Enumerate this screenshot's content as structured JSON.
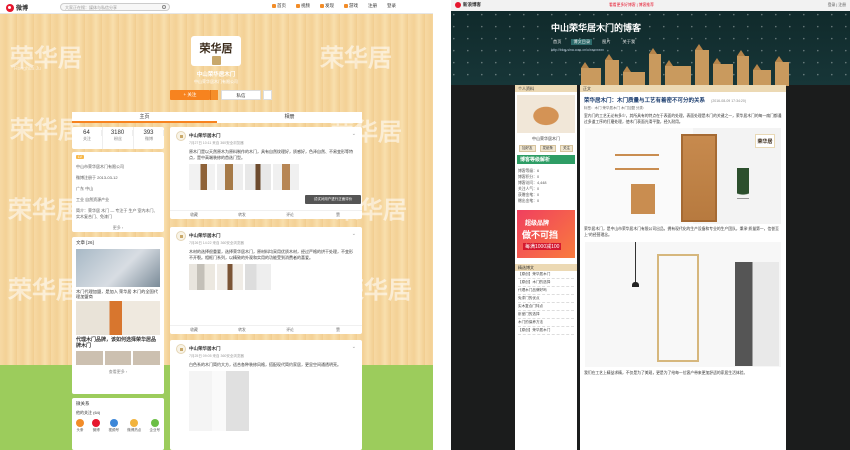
{
  "weibo": {
    "logo_text": "微博",
    "search_placeholder": "大家正在搜：媒体与私信分享",
    "nav": [
      "首页",
      "视频",
      "发现",
      "游戏",
      "注册",
      "登录"
    ],
    "watermark": [
      "荣华居",
      "荣华居",
      "荣华居",
      "荣华居",
      "荣华居",
      "荣华居",
      "荣华居",
      "荣华居"
    ],
    "watermark_sub": "Ronghua Ju",
    "brand_logo": "荣华居",
    "profile_name": "中山荣华居木门",
    "profile_sub": "中山荣华居木门有限公司",
    "follow_label": "+ 关注",
    "message_label": "私信",
    "tabs": [
      "主页",
      "相册"
    ],
    "stats": [
      {
        "n": "64",
        "l": "关注"
      },
      {
        "n": "3180",
        "l": "粉丝"
      },
      {
        "n": "393",
        "l": "微博"
      }
    ],
    "info": {
      "level": "LV",
      "company": "中山市荣华居木门有限公司",
      "registered": "微博注册于 2013-03-12",
      "location": "广东 中山",
      "industry": "工业 自然资源产业",
      "desc": "简介：荣华居 木门 — 专注于 生产 室内木门、实木复合门、免漆门",
      "more": "更多 ›"
    },
    "album": {
      "title": "文章 [26]",
      "caption1": "木门代理加盟，是加入 荣华居 木门的全国代理加盟商",
      "caption2": "代理木门品牌，该如何选择荣华居品牌木门",
      "more": "查看更多 ›"
    },
    "apps": {
      "title": "微关系",
      "sub": "他的关注 (64)",
      "items": [
        "头条",
        "微博",
        "视频号",
        "微博热点",
        "企业号"
      ]
    },
    "posts": [
      {
        "name": "中山荣华居木门",
        "time": "7月27日 10:11 来自 360安全浏览器",
        "text": "原木门是以天然原木为原料制作的木门，具有自然纹理好，质感好，色泽自然、不易变形等特点，是中高端装修的首选门型。",
        "actions": [
          "收藏",
          "转发",
          "评论",
          "赞"
        ]
      },
      {
        "name": "中山荣华居木门",
        "time": "7月26日 14:22 来自 360安全浏览器",
        "text": "木材的选择很重要，选择荣华居木门，原材料均采用优质木材，经过严格的烘干处理，不变形不开裂。相框门系列，以精致的外观和实用的功能受到消费者的喜爱。",
        "actions": [
          "收藏",
          "转发",
          "评论",
          "赞"
        ]
      },
      {
        "name": "中山荣华居木门",
        "time": "7月25日 09:05 来自 360安全浏览器",
        "text": "白色系的木门简约大方，适合各种装修风格，搭配现代简约家居，更显空间通透明亮。",
        "actions": [
          "收藏",
          "转发",
          "评论",
          "赞"
        ]
      }
    ],
    "toast": "试试对用户进行正面评价"
  },
  "blog": {
    "topbar_logo": "新浪博客",
    "promo": "看看更多好博客 | 博客推荐",
    "links": "登录 | 注册",
    "title": "中山荣华居木门的博客",
    "tabs": [
      "首页",
      "博文目录",
      "图片",
      "关于我"
    ],
    "url": "http://blog.sina.com.cn/u/xxxxxxxx",
    "side_head": "个人资料",
    "username": "中山荣华居木门",
    "btn_add": "加好友",
    "btn_msg": "发纸条",
    "btn_follow": "关注",
    "level_info": "博客等级：6\n博客积分：0\n博客访问：4,448\n关注人气：0\n获赠金笔：0\n赠出金笔：0",
    "level_title": "博客等级解析",
    "ad_line1": "超级品牌",
    "ad_line2": "做不可挡",
    "ad_line3": "每满1000减100",
    "list_head": "精选博文",
    "list": [
      "【原创】荣华居木门",
      "【原创】木门的选择",
      "代理木门品牌好吗",
      "免漆门的优点",
      "实木复合门特点",
      "卧室门的选择",
      "木门的保养方法",
      "【原创】荣华居木门"
    ],
    "main_head": "正文",
    "post_title": "荣华居木门：木门质量与工艺有着密不可分的关系",
    "post_date": "(2016-08-09 17:34:20)",
    "post_tags": "标签：木门 荣华居木门 木门加盟 分类：",
    "p1": "室内门的工艺无论有多少，其所具有的特点在于表面的处理，表面处理是木门的关键之一，荣华居木门的每一扇门都通过多道工序的打磨处理，使木门表面光滑平整，经久耐用。",
    "p2": "荣华居木门，是中山市荣华居木门有限公司出品，拥有现代化的生产设备和专业的生产团队，秉承“质量第一，信誉至上”的经营理念。",
    "p3": "我们在工艺上精益求精，不仅是为了美观，更是为了给每一位客户带来更加舒适的家居生活体验。",
    "logo_on_photo": "荣华居"
  }
}
